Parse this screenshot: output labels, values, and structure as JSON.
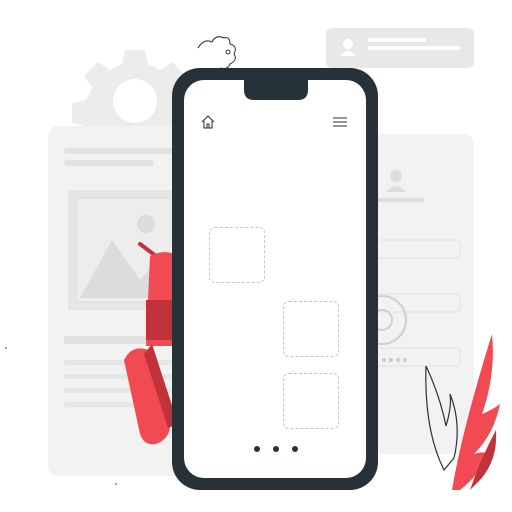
{
  "colors": {
    "phone_body": "#263238",
    "screen": "#ffffff",
    "accent_red": "#f24a52",
    "accent_dark_red": "#c1323b",
    "background_gray": "#efefef",
    "icon_gray": "#bdbdbd",
    "slot_border": "#c6c6c6"
  },
  "phone": {
    "home_icon": "home-icon",
    "menu_icon": "hamburger-menu-icon",
    "placeholders": [
      "slot-1",
      "slot-2",
      "slot-3"
    ],
    "page_indicator_dots": 3
  },
  "background": {
    "decorations": [
      "gear-icon",
      "user-card",
      "image-placeholder",
      "android-robot",
      "red-plant"
    ]
  }
}
